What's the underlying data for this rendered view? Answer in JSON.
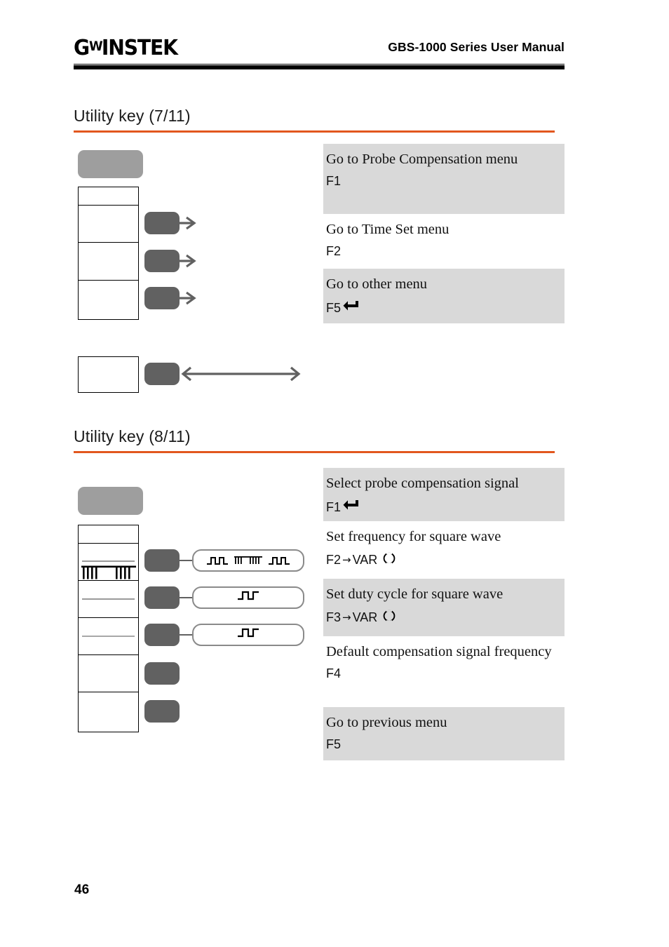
{
  "header": {
    "brand_prefix": "G",
    "brand_mid": "W",
    "brand_suffix": "INSTEK",
    "manual_title": "GBS-1000 Series User Manual"
  },
  "sections": [
    {
      "heading": "Utility key (7/11)",
      "rows": [
        {
          "title": "Go to Probe Compensation menu",
          "key": "F1",
          "icon": "return-icon",
          "shaded": true
        },
        {
          "title": "Go to Time Set menu",
          "key": "F2",
          "icon": "",
          "shaded": false
        },
        {
          "title": "Go to other menu",
          "key": "F5",
          "icon": "return-icon",
          "shaded": true
        }
      ]
    },
    {
      "heading": "Utility key (8/11)",
      "rows": [
        {
          "title": "Select probe compensation signal",
          "key": "F1",
          "icon": "return-icon",
          "shaded": true
        },
        {
          "title": "Set frequency for square wave",
          "key": "F2",
          "arrow": "→",
          "key2": "VAR",
          "icon": "knob-icon",
          "shaded": false
        },
        {
          "title": "Set duty cycle for square wave",
          "key": "F3",
          "arrow": "→",
          "key2": "VAR",
          "icon": "knob-icon",
          "shaded": true
        },
        {
          "title": "Default compensation signal frequency",
          "key": "F4",
          "icon": "",
          "shaded": false
        },
        {
          "title": "Go to previous menu",
          "key": "F5",
          "icon": "",
          "shaded": true
        }
      ]
    }
  ],
  "diagram": {
    "screen_button_label": "display-screen",
    "fkey_label": "function-key",
    "callouts": [
      {
        "name": "frequency-menu-callout",
        "glyphs": [
          "square-wave-icon",
          "comb-wave-icon",
          "square-wave-icon"
        ]
      },
      {
        "name": "duty-cycle-menu-callout",
        "glyphs": [
          "square-wave-icon"
        ]
      },
      {
        "name": "default-freq-menu-callout",
        "glyphs": [
          "square-wave-icon"
        ]
      }
    ]
  },
  "colors": {
    "accent_orange": "#E2571E",
    "shaded_row": "#d9d9d9",
    "fkey_gray": "#616161",
    "screen_gray": "#9e9e9e"
  },
  "footer": {
    "page_number": "46"
  }
}
